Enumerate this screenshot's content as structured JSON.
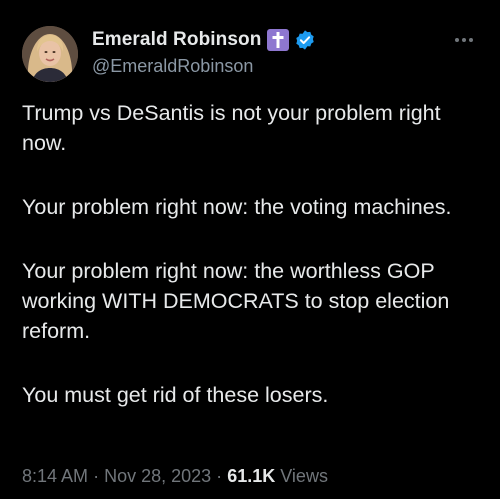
{
  "author": {
    "display_name": "Emerald Robinson",
    "handle": "@EmeraldRobinson",
    "badges": [
      "cross-icon",
      "verified-badge-icon"
    ]
  },
  "tweet": {
    "paragraphs": [
      "Trump vs DeSantis is not your problem right now.",
      "Your problem right now: the voting machines.",
      "Your problem right now: the worthless GOP working WITH DEMOCRATS to stop election reform.",
      "You must get rid of these losers."
    ]
  },
  "meta": {
    "time": "8:14 AM",
    "separator": "·",
    "date": "Nov 28, 2023",
    "views_count": "61.1K",
    "views_label": "Views"
  },
  "colors": {
    "background": "#000000",
    "text": "#e7e9ea",
    "secondary_text": "#71767b",
    "verified_blue": "#1d9bf0",
    "cross_badge": "#8e77d0"
  }
}
